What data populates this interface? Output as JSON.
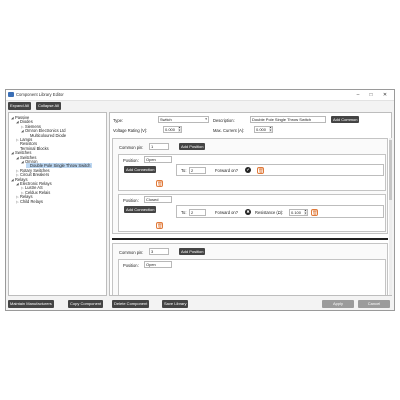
{
  "window": {
    "title": "Component Library Editor",
    "minimize": "–",
    "maximize": "□",
    "close": "✕"
  },
  "toolbar": {
    "expand_all": "Expand All",
    "collapse_all": "Collapse All"
  },
  "tree": [
    {
      "label": "Passive",
      "level": 0,
      "caret": "◢"
    },
    {
      "label": "Diodes",
      "level": 1,
      "caret": "◢"
    },
    {
      "label": "Siemens",
      "level": 2,
      "caret": "▷"
    },
    {
      "label": "Omron Electronics Ltd",
      "level": 2,
      "caret": "◢"
    },
    {
      "label": "Multicoloured Diode",
      "level": 3,
      "caret": ""
    },
    {
      "label": "Lamps",
      "level": 1,
      "caret": "▷"
    },
    {
      "label": "Resistors",
      "level": 1,
      "caret": ""
    },
    {
      "label": "Terminal Blocks",
      "level": 1,
      "caret": ""
    },
    {
      "label": "Switches",
      "level": 0,
      "caret": "◢"
    },
    {
      "label": "Switches",
      "level": 1,
      "caret": "◢"
    },
    {
      "label": "Omron",
      "level": 2,
      "caret": "◢"
    },
    {
      "label": "Double Pole Single Throw Switch",
      "level": 3,
      "caret": "",
      "selected": true
    },
    {
      "label": "Rotary Switches",
      "level": 1,
      "caret": "▷"
    },
    {
      "label": "Circuit Breakers",
      "level": 1,
      "caret": "▷"
    },
    {
      "label": "Relays",
      "level": 0,
      "caret": "◢"
    },
    {
      "label": "Electronic Relays",
      "level": 1,
      "caret": "◢"
    },
    {
      "label": "Lustre AS",
      "level": 2,
      "caret": "▷"
    },
    {
      "label": "Celdux Relais",
      "level": 2,
      "caret": "▷"
    },
    {
      "label": "Relays",
      "level": 1,
      "caret": "▷"
    },
    {
      "label": "Child Relays",
      "level": 1,
      "caret": "▷"
    }
  ],
  "form": {
    "type_label": "Type:",
    "type_value": "Switch",
    "description_label": "Description:",
    "description_value": "Double Pole Single Throw Switch",
    "add_common": "Add Common",
    "voltage_label": "Voltage Rating (V):",
    "voltage_value": "0.000",
    "current_label": "Max. Current (A):",
    "current_value": "0.000"
  },
  "commons": [
    {
      "pin_label": "Common pin:",
      "pin_value": "1",
      "add_position": "Add Position",
      "positions": [
        {
          "label": "Position:",
          "value": "Open",
          "add_connection": "Add Connection",
          "connection": {
            "to_label": "To:",
            "to_value": "2",
            "forward_label": "Forward on?",
            "forward_icon": "✔"
          }
        },
        {
          "label": "Position:",
          "value": "Closed",
          "add_connection": "Add Connection",
          "connection": {
            "to_label": "To:",
            "to_value": "2",
            "forward_label": "Forward on?",
            "forward_icon": "✖",
            "resistance_label": "Resistance (Ω):",
            "resistance_value": "0.100"
          }
        }
      ]
    },
    {
      "pin_label": "Common pin:",
      "pin_value": "3",
      "add_position": "Add Position",
      "positions": [
        {
          "label": "Position:",
          "value": "Open"
        }
      ]
    }
  ],
  "delete_icon": "🗑",
  "bottom": {
    "maintain": "Maintain Manufacturers",
    "copy": "Copy Component",
    "delete": "Delete Component",
    "save": "Save Library",
    "apply": "Apply",
    "cancel": "Cancel"
  },
  "colors": {
    "dark_button": "#444444",
    "disabled_button": "#9b9b9b",
    "delete_accent": "#e07a3a",
    "selection": "#bcd7f2"
  }
}
